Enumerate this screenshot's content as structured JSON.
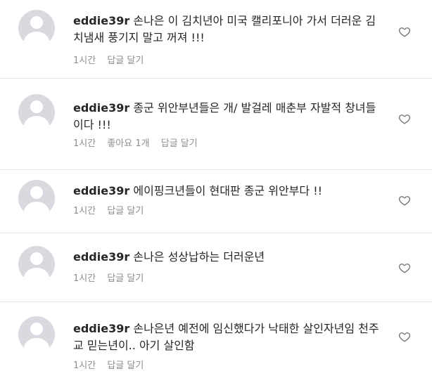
{
  "comments": [
    {
      "username": "eddie39r",
      "text": "손나은 이 김치년아 미국 캘리포니아 가서 더러운 김치냄새 풍기지 말고 꺼져 !!!",
      "time": "1시간",
      "likes": "",
      "reply": "답글 달기"
    },
    {
      "username": "eddie39r",
      "text": "종군 위안부년들은 개/ 발걸레 매춘부 자발적 창녀들이다 !!!",
      "time": "1시간",
      "likes": "좋아요 1개",
      "reply": "답글 달기"
    },
    {
      "username": "eddie39r",
      "text": "에이핑크년들이 현대판 종군 위안부다 !!",
      "time": "1시간",
      "likes": "",
      "reply": "답글 달기"
    },
    {
      "username": "eddie39r",
      "text": "손나은 성상납하는 더러운년",
      "time": "1시간",
      "likes": "",
      "reply": "답글 달기"
    },
    {
      "username": "eddie39r",
      "text": "손나은년 예전에 임신했다가 낙태한 살인자년임 천주교 믿는년이.. 아기 살인함",
      "time": "1시간",
      "likes": "",
      "reply": "답글 달기"
    }
  ],
  "icons": {
    "avatar": "default-avatar-icon",
    "like": "heart-outline-icon"
  },
  "colors": {
    "text": "#262626",
    "muted": "#8e8e8e",
    "divider": "#e6e6e6",
    "avatar_bg": "#d8dae0"
  }
}
